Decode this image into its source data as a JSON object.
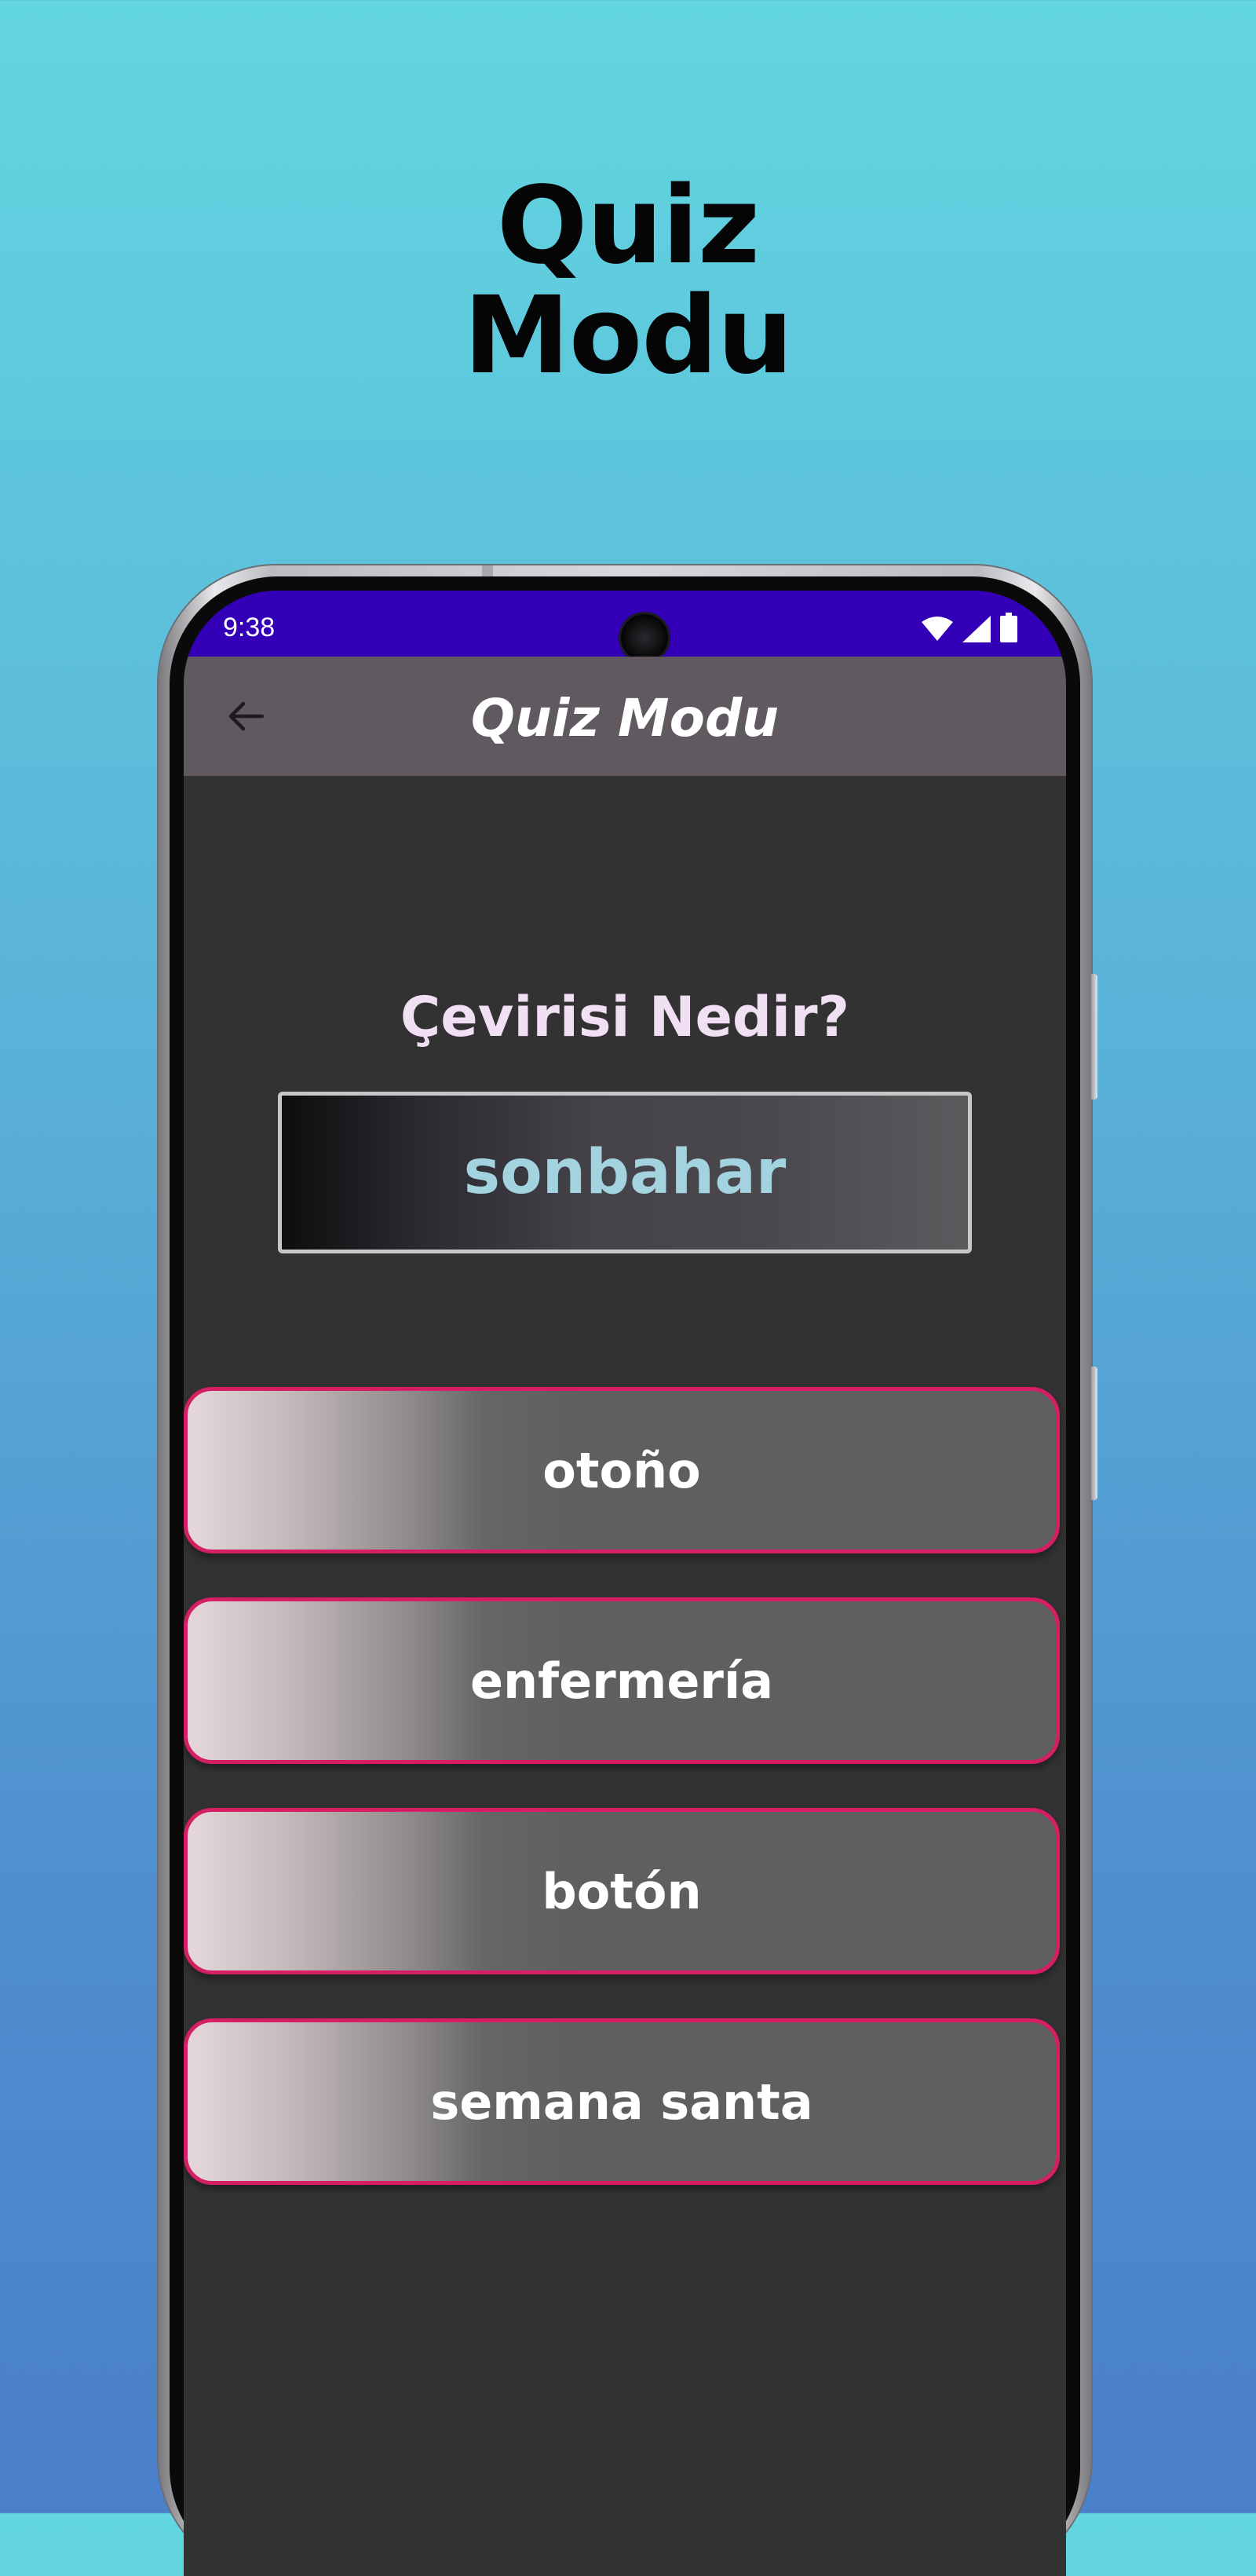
{
  "promo": {
    "headline_line1": "Quiz",
    "headline_line2": "Modu"
  },
  "statusbar": {
    "time": "9:38",
    "icons": [
      "wifi-icon",
      "signal-icon",
      "battery-icon"
    ]
  },
  "appbar": {
    "back_icon": "arrow-left-icon",
    "title": "Quiz Modu"
  },
  "quiz": {
    "question": "Çevirisi Nedir?",
    "word": "sonbahar",
    "options": [
      "otoño",
      "enfermería",
      "botón",
      "semana santa"
    ]
  },
  "colors": {
    "statusbar": "#3300b7",
    "appbar": "#605a60",
    "screen_bg": "#333232",
    "question_text": "#f1dff4",
    "word_text": "#a3d3df",
    "answer_border": "#d51e63"
  }
}
